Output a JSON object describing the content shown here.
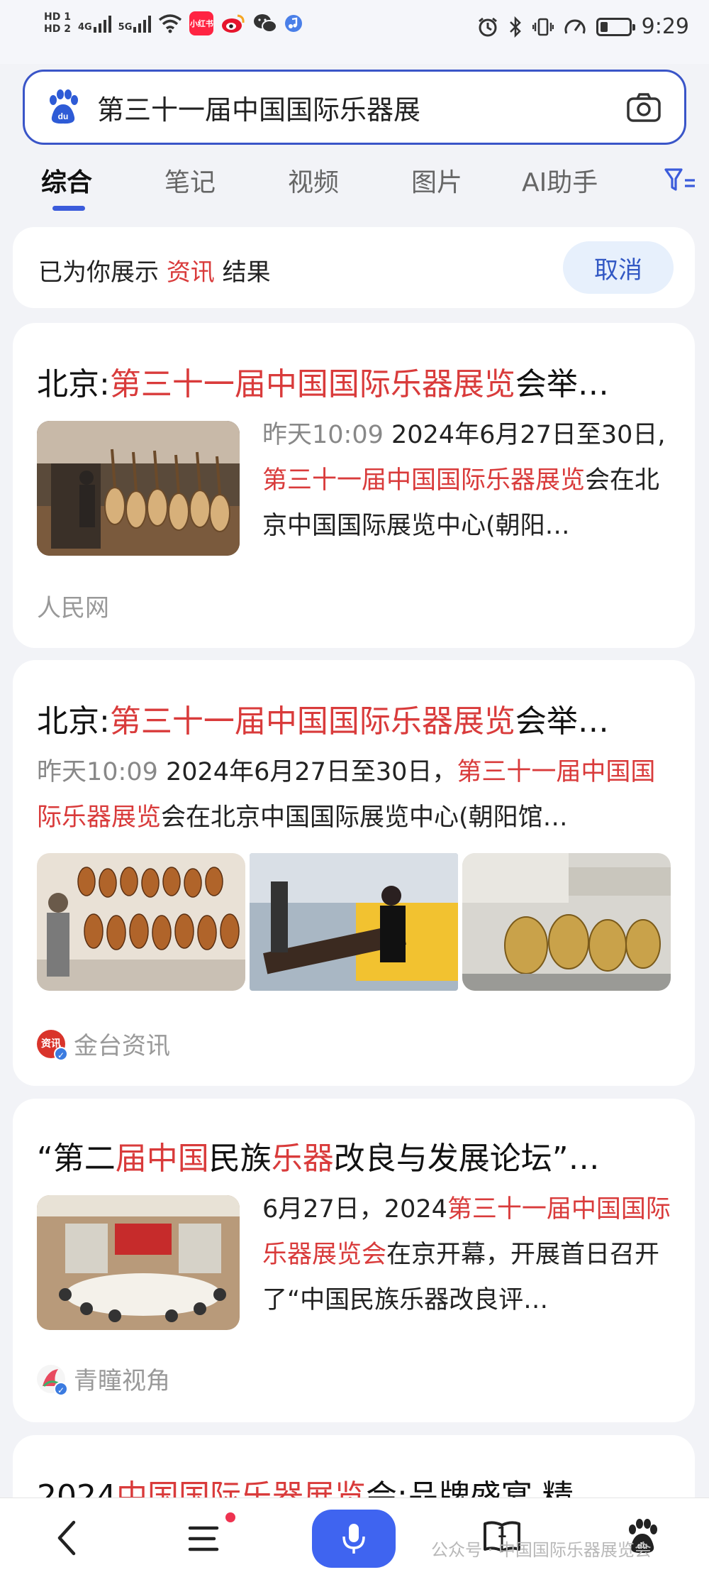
{
  "status_bar": {
    "hd1": "HD 1",
    "hd2": "HD 2",
    "net1": "4G",
    "net2": "5G",
    "app_xiaohongshu": "小红书",
    "time": "9:29",
    "battery_level": 0.25
  },
  "search": {
    "query": "第三十一届中国国际乐器展",
    "logo_icon": "baidu-paw-icon",
    "camera_icon": "camera-icon"
  },
  "tabs": [
    {
      "label": "综合",
      "active": true
    },
    {
      "label": "笔记",
      "active": false
    },
    {
      "label": "视频",
      "active": false
    },
    {
      "label": "图片",
      "active": false
    },
    {
      "label": "AI助手",
      "active": false
    }
  ],
  "info_bar": {
    "prefix": "已为你展示",
    "highlight": "资讯",
    "suffix": "结果",
    "cancel_label": "取消"
  },
  "results": [
    {
      "title_pre": "北京:",
      "title_hl": "第三十一届中国国际乐器展览",
      "title_post": "会举…",
      "time": "昨天10:09",
      "snippet_pre": " 2024年6月27日至30日,",
      "snippet_hl": "第三十一届中国国际乐器展览",
      "snippet_post": "会在北京中国国际展览中心(朝阳…",
      "source": "人民网"
    },
    {
      "title_pre": "北京:",
      "title_hl": "第三十一届中国国际乐器展览",
      "title_post": "会举…",
      "time": "昨天10:09",
      "snippet_pre": " 2024年6月27日至30日，",
      "snippet_hl": "第三十一届中国国际乐器展览",
      "snippet_post": "会在北京中国国际展览中心(朝阳馆…",
      "source": "金台资讯",
      "source_icon_text": "资讯"
    },
    {
      "title_a": "“第二",
      "title_b": "届中国",
      "title_c": "民族",
      "title_d": "乐器",
      "title_e": "改良与发展论坛”…",
      "snippet_pre": "6月27日，2024",
      "snippet_hl": "第三十一届中国国际乐器展览会",
      "snippet_post": "在京开幕，开展首日召开了“中国民族乐器改良评…",
      "source": "青瞳视角"
    },
    {
      "title_pre": "2024",
      "title_hl": "中国国际乐器展览",
      "title_post": "会:品牌盛宴 精"
    }
  ],
  "bottom_nav": {
    "book_count": "1",
    "watermark": "公众号 · 中国国际乐器展览会"
  },
  "colors": {
    "accent_blue": "#3b5bdb",
    "highlight_red": "#d93b3b",
    "mic_blue": "#3f64f0"
  }
}
